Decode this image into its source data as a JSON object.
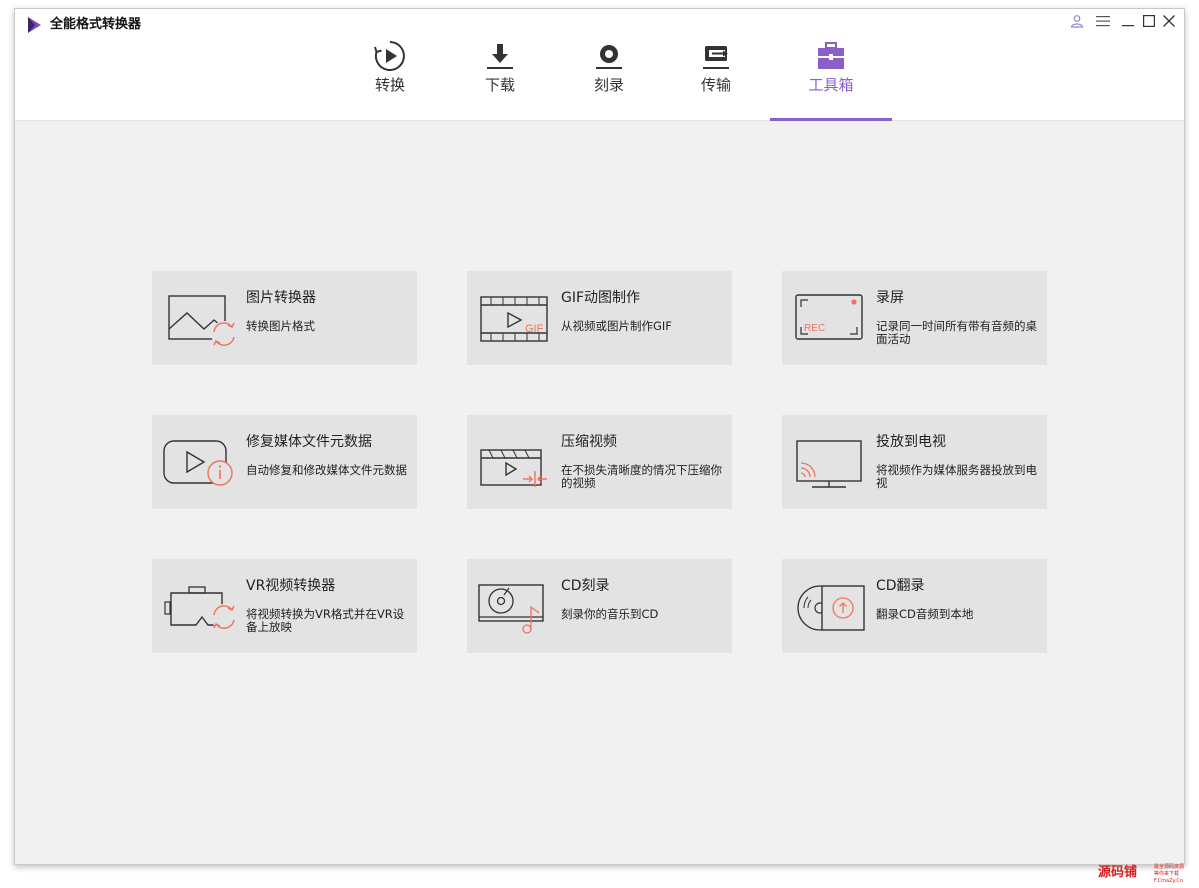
{
  "app": {
    "title": "全能格式转换器"
  },
  "tabs": [
    {
      "id": "convert",
      "label": "转换",
      "icon": "convert-icon"
    },
    {
      "id": "download",
      "label": "下载",
      "icon": "download-icon"
    },
    {
      "id": "burn",
      "label": "刻录",
      "icon": "burn-icon"
    },
    {
      "id": "transfer",
      "label": "传输",
      "icon": "transfer-icon"
    },
    {
      "id": "toolbox",
      "label": "工具箱",
      "icon": "toolbox-icon",
      "active": true
    }
  ],
  "tools": [
    {
      "title": "图片转换器",
      "desc": "转换图片格式",
      "icon": "image-convert-icon"
    },
    {
      "title": "GIF动图制作",
      "desc": "从视频或图片制作GIF",
      "icon": "gif-maker-icon"
    },
    {
      "title": "录屏",
      "desc": "记录同一时间所有带有音频的桌面活动",
      "icon": "screen-record-icon"
    },
    {
      "title": "修复媒体文件元数据",
      "desc": "自动修复和修改媒体文件元数据",
      "icon": "metadata-fix-icon"
    },
    {
      "title": "压缩视频",
      "desc": "在不损失清晰度的情况下压缩你的视频",
      "icon": "compress-video-icon"
    },
    {
      "title": "投放到电视",
      "desc": "将视频作为媒体服务器投放到电视",
      "icon": "cast-tv-icon"
    },
    {
      "title": "VR视频转换器",
      "desc": "将视频转换为VR格式并在VR设备上放映",
      "icon": "vr-convert-icon"
    },
    {
      "title": "CD刻录",
      "desc": "刻录你的音乐到CD",
      "icon": "cd-burn-icon"
    },
    {
      "title": "CD翻录",
      "desc": "翻录CD音频到本地",
      "icon": "cd-rip-icon"
    }
  ],
  "watermark": {
    "text": "源码铺",
    "line1": "最全源码资源",
    "line2": "等你来下载",
    "line3": "F.CmaZy.Cn"
  },
  "colors": {
    "accent": "#8b5fc9",
    "icon_highlight": "#f0725c",
    "card_bg": "#e3e3e3",
    "content_bg": "#f1f1f1"
  }
}
